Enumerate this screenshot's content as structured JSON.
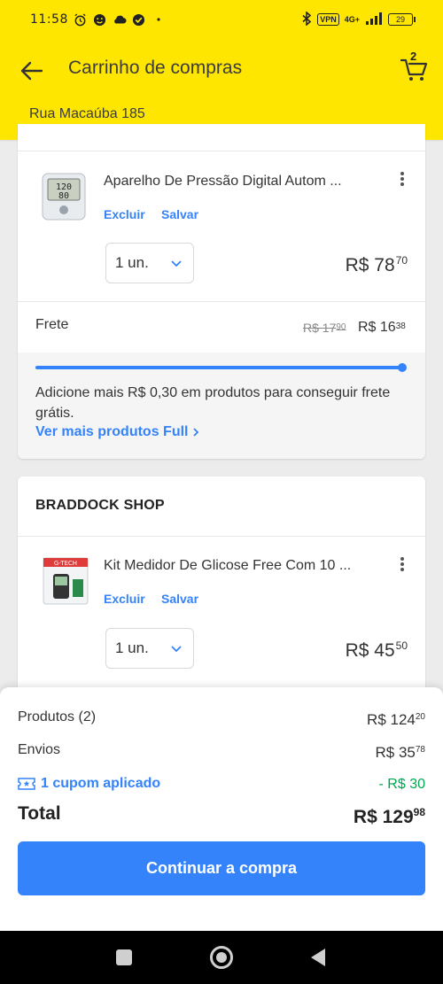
{
  "status_bar": {
    "time": "11:58",
    "vpn": "VPN",
    "network": "4G+",
    "battery": "29"
  },
  "header": {
    "title": "Carrinho de compras",
    "cart_count": "2",
    "address": "Rua Macaúba 185"
  },
  "cart": {
    "items": [
      {
        "title": "Aparelho De Pressão Digital Autom ...",
        "delete_label": "Excluir",
        "save_label": "Salvar",
        "quantity": "1 un.",
        "price_currency": "R$",
        "price_int": "78",
        "price_cents": "70"
      },
      {
        "title": "Kit Medidor De Glicose Free Com 10 ...",
        "delete_label": "Excluir",
        "save_label": "Salvar",
        "quantity": "1 un.",
        "price_currency": "R$",
        "price_int": "45",
        "price_cents": "50"
      }
    ],
    "shipping": {
      "label": "Frete",
      "old_price_int": "R$ 17",
      "old_price_cents": "90",
      "new_price_int": "R$ 16",
      "new_price_cents": "38",
      "progress": 1.0,
      "message": "Adicione mais R$ 0,30 em produtos para conseguir frete grátis.",
      "more_link": "Ver mais produtos Full"
    },
    "shop_name": "BRADDOCK SHOP"
  },
  "summary": {
    "products_label": "Produtos (2)",
    "products_int": "R$ 124",
    "products_cents": "20",
    "shipping_label": "Envios",
    "shipping_int": "R$ 35",
    "shipping_cents": "78",
    "coupon_label": "1 cupom aplicado",
    "coupon_value": "- R$ 30",
    "total_label": "Total",
    "total_int": "R$ 129",
    "total_cents": "98",
    "cta_label": "Continuar a compra"
  },
  "colors": {
    "brand_yellow": "#ffe600",
    "accent_blue": "#3483fa",
    "success_green": "#00a650"
  }
}
